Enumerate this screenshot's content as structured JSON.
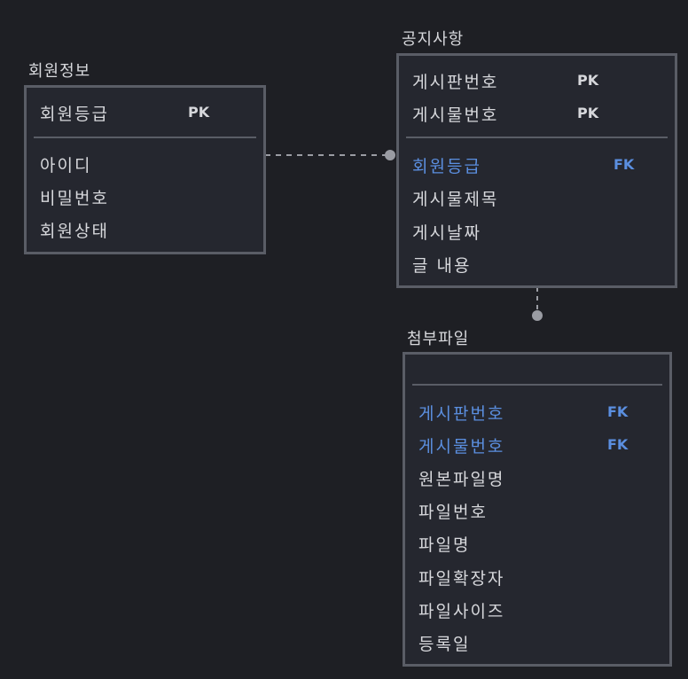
{
  "entities": {
    "member": {
      "title": "회원정보",
      "primary": [
        {
          "name": "회원등급",
          "key": "PK"
        }
      ],
      "fields": [
        {
          "name": "아이디"
        },
        {
          "name": "비밀번호"
        },
        {
          "name": "회원상태"
        }
      ]
    },
    "notice": {
      "title": "공지사항",
      "primary": [
        {
          "name": "게시판번호",
          "key": "PK"
        },
        {
          "name": "게시물번호",
          "key": "PK"
        }
      ],
      "fields": [
        {
          "name": "회원등급",
          "key": "FK"
        },
        {
          "name": "게시물제목"
        },
        {
          "name": "게시날짜"
        },
        {
          "name": "글 내용"
        }
      ]
    },
    "attachment": {
      "title": "첨부파일",
      "primary": [],
      "fields": [
        {
          "name": "게시판번호",
          "key": "FK"
        },
        {
          "name": "게시물번호",
          "key": "FK"
        },
        {
          "name": "원본파일명"
        },
        {
          "name": "파일번호"
        },
        {
          "name": "파일명"
        },
        {
          "name": "파일확장자"
        },
        {
          "name": "파일사이즈"
        },
        {
          "name": "등록일"
        }
      ]
    }
  },
  "colors": {
    "background": "#1e1f24",
    "entity_fill": "#25272f",
    "border": "#5a5d66",
    "text": "#d7d8dc",
    "foreign_key": "#5b8fe0",
    "connector": "#9a9ca3"
  }
}
